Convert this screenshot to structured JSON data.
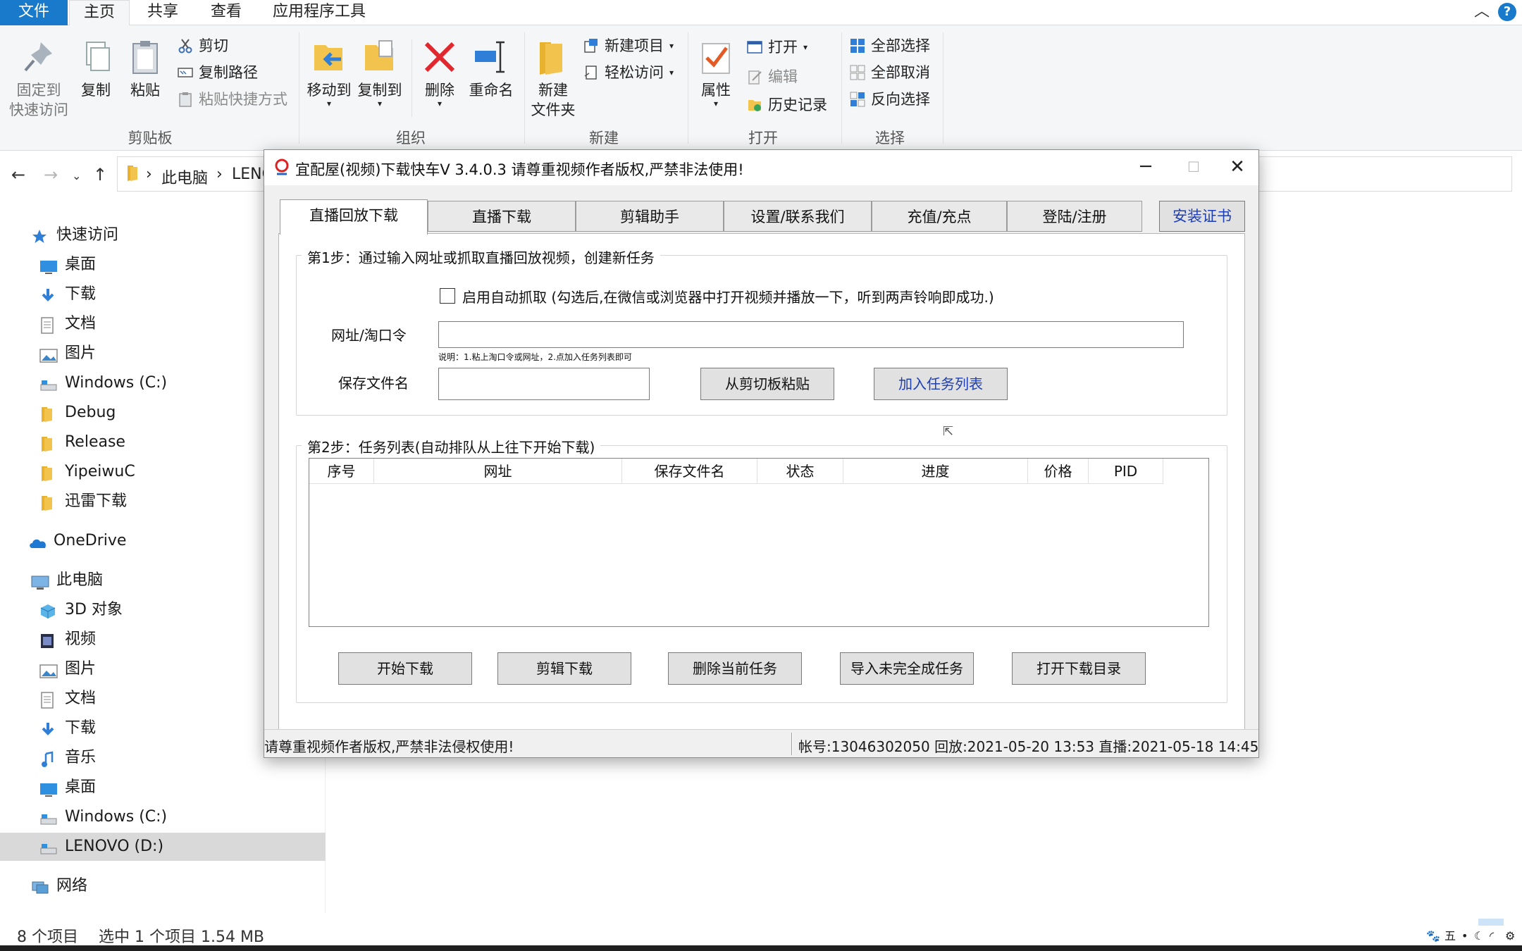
{
  "ribbon": {
    "tabs": [
      "文件",
      "主页",
      "共享",
      "查看",
      "应用程序工具"
    ],
    "groups": {
      "clipboard": {
        "label": "剪贴板",
        "pin": "固定到快速访问",
        "pin_line1": "固定到",
        "pin_line2": "快速访问",
        "copy": "复制",
        "paste": "粘贴",
        "cut": "剪切",
        "copy_path": "复制路径",
        "paste_shortcut": "粘贴快捷方式"
      },
      "organize": {
        "label": "组织",
        "move_to": "移动到",
        "copy_to": "复制到",
        "delete": "删除",
        "rename": "重命名"
      },
      "new": {
        "label": "新建",
        "new_folder_line1": "新建",
        "new_folder_line2": "文件夹",
        "new_item": "新建项目",
        "easy_access": "轻松访问"
      },
      "open": {
        "label": "打开",
        "properties": "属性",
        "open": "打开",
        "edit": "编辑",
        "history": "历史记录"
      },
      "select": {
        "label": "选择",
        "select_all": "全部选择",
        "select_none": "全部取消",
        "invert": "反向选择"
      }
    }
  },
  "address": {
    "crumbs": [
      "此电脑",
      "LENO"
    ]
  },
  "nav_pane": {
    "items": [
      {
        "label": "快速访问",
        "icon": "star-icon"
      },
      {
        "label": "桌面",
        "icon": "desktop-icon"
      },
      {
        "label": "下载",
        "icon": "download-icon"
      },
      {
        "label": "文档",
        "icon": "document-icon"
      },
      {
        "label": "图片",
        "icon": "picture-icon"
      },
      {
        "label": "Windows (C:)",
        "icon": "drive-icon"
      },
      {
        "label": "Debug",
        "icon": "folder-icon"
      },
      {
        "label": "Release",
        "icon": "folder-icon"
      },
      {
        "label": "YipeiwuC",
        "icon": "folder-icon"
      },
      {
        "label": "迅雷下载",
        "icon": "folder-icon"
      },
      {
        "label": "OneDrive",
        "icon": "cloud-icon"
      },
      {
        "label": "此电脑",
        "icon": "computer-icon"
      },
      {
        "label": "3D 对象",
        "icon": "cube-icon"
      },
      {
        "label": "视频",
        "icon": "video-icon"
      },
      {
        "label": "图片",
        "icon": "picture-icon"
      },
      {
        "label": "文档",
        "icon": "document-icon"
      },
      {
        "label": "下载",
        "icon": "download-icon"
      },
      {
        "label": "音乐",
        "icon": "music-icon"
      },
      {
        "label": "桌面",
        "icon": "desktop-icon"
      },
      {
        "label": "Windows (C:)",
        "icon": "drive-icon"
      },
      {
        "label": "LENOVO (D:)",
        "icon": "drive-icon"
      },
      {
        "label": "网络",
        "icon": "network-icon"
      }
    ]
  },
  "status_bar": {
    "items_count": "8 个项目",
    "selection": "选中 1 个项目  1.54 MB"
  },
  "dialog": {
    "title": "宜配屋(视频)下载快车V 3.4.0.3 请尊重视频作者版权,严禁非法使用!",
    "tabs": [
      "直播回放下载",
      "直播下载",
      "剪辑助手",
      "设置/联系我们",
      "充值/充点",
      "登陆/注册"
    ],
    "install_cert": "安装证书",
    "step1": {
      "legend": "第1步：通过输入网址或抓取直播回放视频，创建新任务",
      "auto_capture": "启用自动抓取 (勾选后,在微信或浏览器中打开视频并播放一下，听到两声铃响即成功.)",
      "url_label": "网址/淘口令",
      "url_value": "",
      "hint": "说明：1.粘上淘口令或网址，2.点加入任务列表即可",
      "filename_label": "保存文件名",
      "filename_value": "",
      "paste_btn": "从剪切板粘贴",
      "add_btn": "加入任务列表"
    },
    "step2": {
      "legend": "第2步：任务列表(自动排队从上往下开始下载)",
      "columns": [
        "序号",
        "网址",
        "保存文件名",
        "状态",
        "进度",
        "价格",
        "PID"
      ],
      "buttons": [
        "开始下载",
        "剪辑下载",
        "删除当前任务",
        "导入未完全成任务",
        "打开下载目录"
      ]
    },
    "status_left": "请尊重视频作者版权,严禁非法侵权使用!",
    "status_right": "帐号:13046302050 回放:2021-05-20 13:53 直播:2021-05-18 14:45"
  },
  "colors": {
    "accent": "#1979ca",
    "cert_text": "#1e3fb3",
    "folder": "#f3c44d",
    "delete_red": "#e0282e"
  }
}
